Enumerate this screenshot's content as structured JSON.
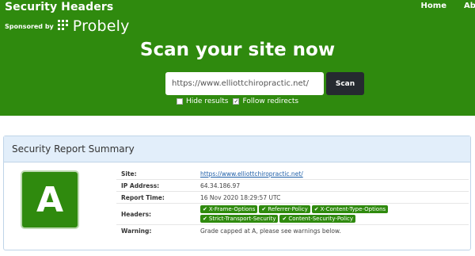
{
  "header": {
    "title": "Security Headers",
    "sponsored_by": "Sponsored by",
    "sponsor_name": "Probely",
    "nav": [
      {
        "label": "Home"
      },
      {
        "label": "About"
      }
    ]
  },
  "hero": {
    "title": "Scan your site now",
    "url_value": "https://www.elliottchiropractic.net/",
    "scan_label": "Scan",
    "options": [
      {
        "label": "Hide results",
        "checked": false
      },
      {
        "label": "Follow redirects",
        "checked": true
      }
    ]
  },
  "summary": {
    "title": "Security Report Summary",
    "grade": "A",
    "grade_color": "#2f8a0e",
    "rows": {
      "site": {
        "label": "Site:",
        "value": "https://www.elliottchiropractic.net/"
      },
      "ip": {
        "label": "IP Address:",
        "value": "64.34.186.97"
      },
      "time": {
        "label": "Report Time:",
        "value": "16 Nov 2020 18:29:57 UTC"
      },
      "headers": {
        "label": "Headers:",
        "items": [
          "X-Frame-Options",
          "Referrer-Policy",
          "X-Content-Type-Options",
          "Strict-Transport-Security",
          "Content-Security-Policy"
        ]
      },
      "warning": {
        "label": "Warning:",
        "value": "Grade capped at A, please see warnings below."
      }
    }
  },
  "colors": {
    "brand_green": "#2f8a0e",
    "panel_header": "#e2eefa",
    "scan_button": "#252a30"
  }
}
